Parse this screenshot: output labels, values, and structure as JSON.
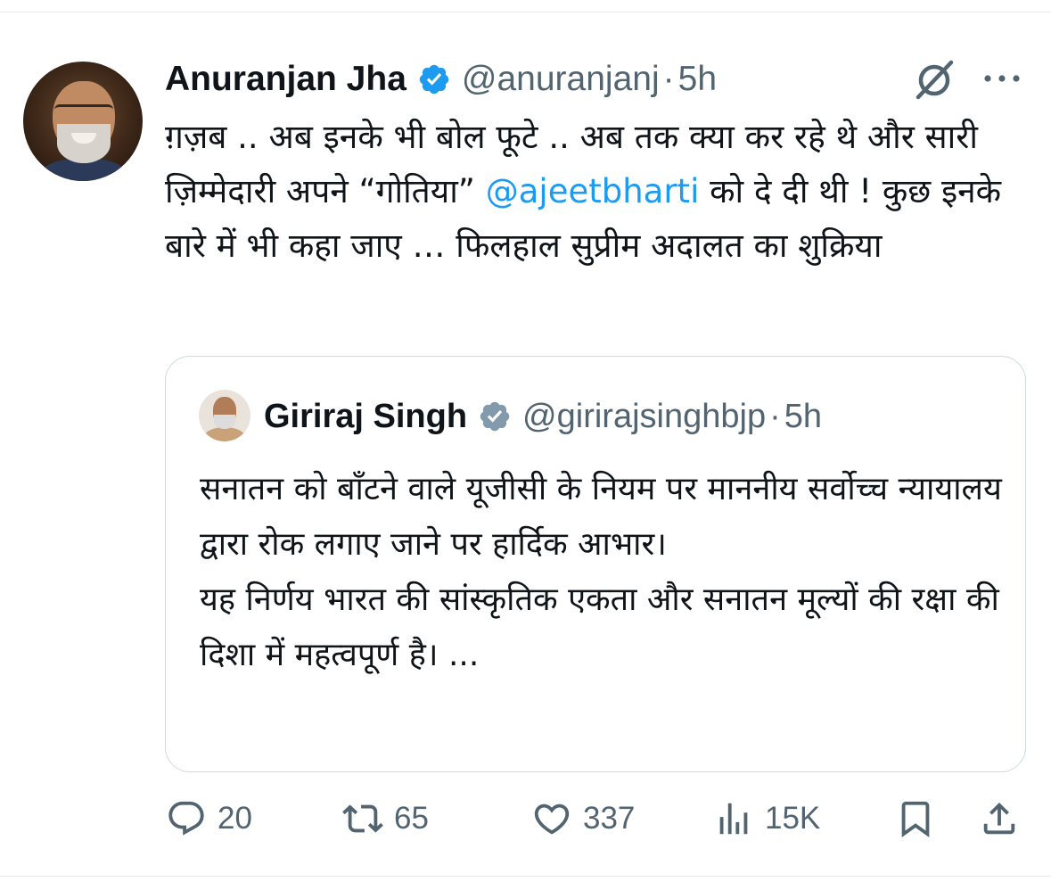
{
  "tweet": {
    "author": {
      "name": "Anuranjan Jha",
      "handle": "@anuranjanj",
      "time": "5h",
      "separator": "·"
    },
    "text": {
      "part1": "ग़ज़ब .. अब इनके भी बोल फूटे .. अब तक क्या कर रहे थे और सारी ज़िम्मेदारी अपने “गोतिया” ",
      "mention": "@ajeetbharti",
      "part2": " को दे दी थी ! कुछ इनके बारे में भी कहा जाए … फिलहाल सुप्रीम अदालत का शुक्रिया"
    }
  },
  "quote": {
    "author": {
      "name": "Giriraj Singh",
      "handle": "@girirajsinghbjp",
      "time": "5h",
      "separator": "·"
    },
    "text": {
      "para1": "सनातन को बाँटने वाले यूजीसी के नियम पर माननीय सर्वोच्च न्यायालय द्वारा रोक लगाए जाने पर हार्दिक आभार।",
      "para2": "यह निर्णय भारत की सांस्कृतिक एकता और सनातन मूल्यों की रक्षा की दिशा में महत्वपूर्ण है। ..."
    }
  },
  "actions": {
    "replies": "20",
    "reposts": "65",
    "likes": "337",
    "views": "15K"
  },
  "icons": {
    "verified": "verified-badge-icon",
    "verified_color_primary": "#1d9bf0",
    "verified_color_quote": "#829aab",
    "grok": "grok-icon",
    "more": "more-icon",
    "reply": "reply-icon",
    "repost": "repost-icon",
    "like": "heart-icon",
    "views": "views-icon",
    "bookmark": "bookmark-icon",
    "share": "share-icon"
  },
  "colors": {
    "mention": "#1d9bf0",
    "secondary_text": "#536471",
    "border": "#cfd9de"
  }
}
